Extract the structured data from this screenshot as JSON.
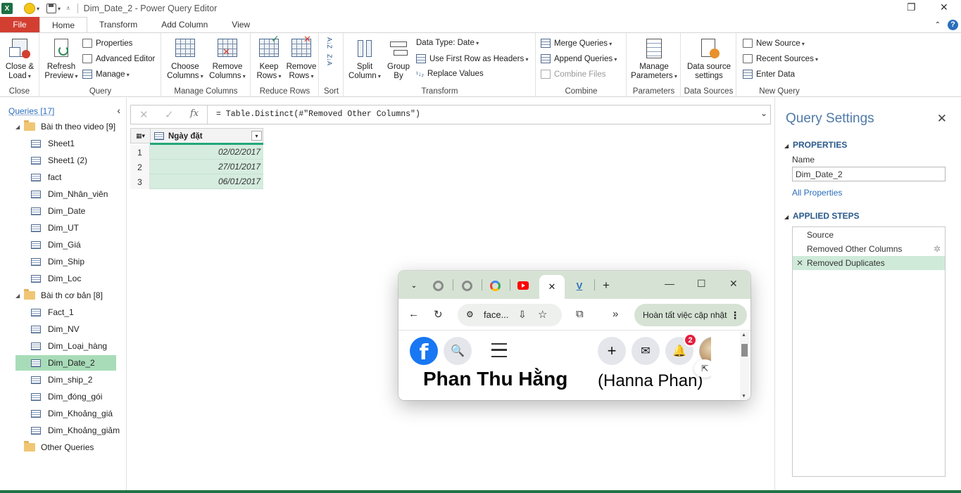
{
  "window": {
    "title": "Dim_Date_2 - Power Query Editor",
    "app_icon_letter": "X"
  },
  "ribbon_tabs": [
    "File",
    "Home",
    "Transform",
    "Add Column",
    "View"
  ],
  "ribbon": {
    "close_group": {
      "label": "Close",
      "close_load": [
        "Close &",
        "Load"
      ]
    },
    "query_group": {
      "label": "Query",
      "refresh": [
        "Refresh",
        "Preview"
      ],
      "properties": "Properties",
      "advanced_editor": "Advanced Editor",
      "manage": "Manage"
    },
    "manage_columns_group": {
      "label": "Manage Columns",
      "choose": [
        "Choose",
        "Columns"
      ],
      "remove": [
        "Remove",
        "Columns"
      ]
    },
    "reduce_rows_group": {
      "label": "Reduce Rows",
      "keep": [
        "Keep",
        "Rows"
      ],
      "remove": [
        "Remove",
        "Rows"
      ]
    },
    "sort_group": {
      "label": "Sort",
      "asc_glyph": "A↓Z",
      "desc_glyph": "Z↓A"
    },
    "transform_group": {
      "label": "Transform",
      "split": [
        "Split",
        "Column"
      ],
      "group_by": [
        "Group",
        "By"
      ],
      "data_type": "Data Type: Date",
      "first_row_headers": "Use First Row as Headers",
      "replace_values": "Replace Values"
    },
    "combine_group": {
      "label": "Combine",
      "merge": "Merge Queries",
      "append": "Append Queries",
      "combine_files": "Combine Files"
    },
    "parameters_group": {
      "label": "Parameters",
      "manage": [
        "Manage",
        "Parameters"
      ]
    },
    "data_sources_group": {
      "label": "Data Sources",
      "settings": [
        "Data source",
        "settings"
      ]
    },
    "new_query_group": {
      "label": "New Query",
      "new_source": "New Source",
      "recent_sources": "Recent Sources",
      "enter_data": "Enter Data"
    }
  },
  "queries_pane": {
    "header": "Queries [17]",
    "folders": [
      {
        "name": "Bài th theo video [9]",
        "items": [
          "Sheet1",
          "Sheet1 (2)",
          "fact",
          "Dim_Nhân_viên",
          "Dim_Date",
          "Dim_UT",
          "Dim_Giá",
          "Dim_Ship",
          "Dim_Loc"
        ]
      },
      {
        "name": "Bài th cơ bản [8]",
        "items": [
          "Fact_1",
          "Dim_NV",
          "Dim_Loại_hàng",
          "Dim_Date_2",
          "Dim_ship_2",
          "Dim_đóng_gói",
          "Dim_Khoảng_giá",
          "Dim_Khoảng_giảm"
        ]
      },
      {
        "name": "Other Queries",
        "items": []
      }
    ],
    "selected": "Dim_Date_2"
  },
  "formula_bar": {
    "formula": "= Table.Distinct(#\"Removed Other Columns\")",
    "fx": "fx"
  },
  "grid": {
    "column_header": "Ngày đặt",
    "rows": [
      {
        "num": "1",
        "value": "02/02/2017"
      },
      {
        "num": "2",
        "value": "27/01/2017"
      },
      {
        "num": "3",
        "value": "06/01/2017"
      }
    ]
  },
  "query_settings": {
    "title": "Query Settings",
    "properties_header": "PROPERTIES",
    "name_label": "Name",
    "name_value": "Dim_Date_2",
    "all_properties": "All Properties",
    "applied_steps_header": "APPLIED STEPS",
    "steps": [
      "Source",
      "Removed Other Columns",
      "Removed Duplicates"
    ],
    "active_step": "Removed Duplicates"
  },
  "browser_popup": {
    "url": "face...",
    "update_button": "Hoàn tất việc cập nhật",
    "notification_count": "2",
    "profile_name": "Phan Thu Hằng",
    "profile_alt_name": "(Hanna Phan)",
    "fb_logo_letter": "f"
  },
  "colors": {
    "file_tab": "#d23f31",
    "excel_green": "#217346",
    "selection_green": "#a8dcb8",
    "step_active": "#cfead9",
    "link_blue": "#2a6ebb",
    "facebook_blue": "#1877f2",
    "browser_tabstrip": "#d6e3d4"
  }
}
